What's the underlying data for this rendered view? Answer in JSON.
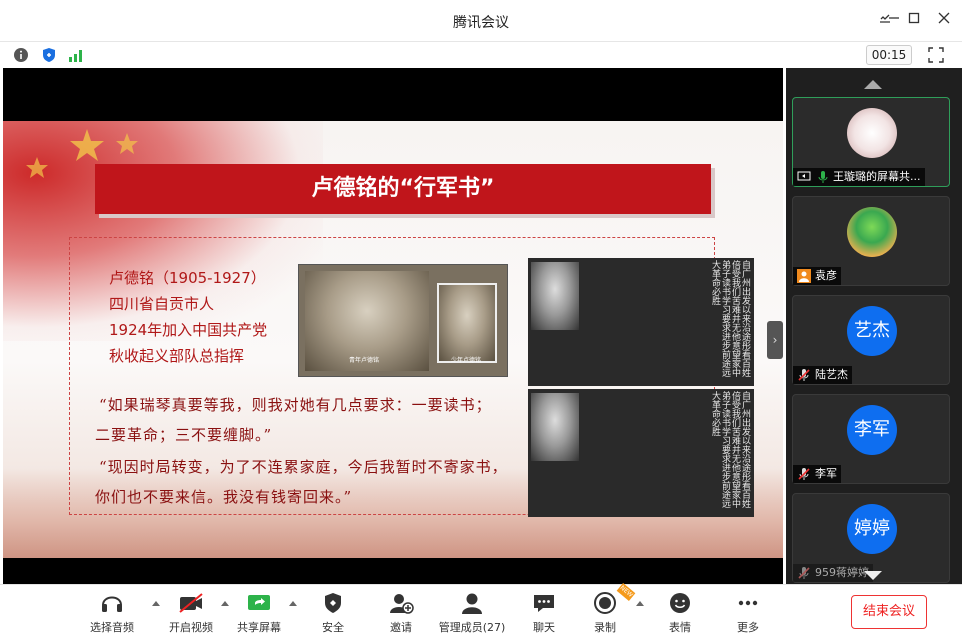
{
  "window": {
    "title": "腾讯会议"
  },
  "status": {
    "timer": "00:15"
  },
  "slide": {
    "heading": "卢德铭的“行军书”",
    "bio": [
      "卢德铭（1905-1927）",
      "四川省自贡市人",
      "1924年加入中国共产党",
      "秋收起义部队总指挥"
    ],
    "quotes": [
      "“如果瑞琴真要等我，则我对她有几点要求：一要读书；",
      "二要革命；三不要缠脚。”",
      "“现因时局转变，为了不连累家庭，今后我暂时不寄家书，",
      "你们也不要来信。我没有钱寄回来。”"
    ],
    "photo_captions": [
      "青年卢德铭",
      "少年卢德铭"
    ],
    "letter_text": "自广州出发以来沿途彤看百姓倍受我们苦难并无他意望家中弟子读书学习要求进步前途远大革命必胜"
  },
  "participants": [
    {
      "name": "王璇璐的屏幕共...",
      "type": "image",
      "mic": "on",
      "active": true
    },
    {
      "name": "袁彦",
      "type": "image",
      "mic": "none",
      "active": false
    },
    {
      "name": "陆艺杰",
      "type": "initial",
      "initial": "艺杰",
      "mic": "muted",
      "active": false
    },
    {
      "name": "李军",
      "type": "initial",
      "initial": "李军",
      "mic": "muted",
      "active": false
    },
    {
      "name": "959蒋婷婷",
      "type": "initial",
      "initial": "婷婷",
      "mic": "muted",
      "active": false
    }
  ],
  "toolbar": {
    "audio": "选择音频",
    "video": "开启视频",
    "share": "共享屏幕",
    "security": "安全",
    "invite": "邀请",
    "members": "管理成员(27)",
    "chat": "聊天",
    "record": "录制",
    "reactions": "表情",
    "more": "更多",
    "end": "结束会议",
    "new_badge": "NEW"
  },
  "colors": {
    "accent": "#0e6ef0",
    "slide_red": "#c0151b",
    "end_red": "#e22222",
    "active_border": "#2f9e5a"
  }
}
